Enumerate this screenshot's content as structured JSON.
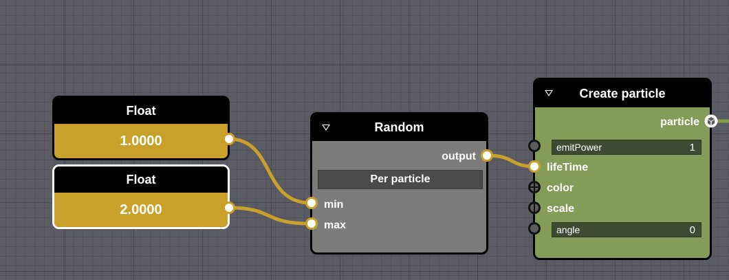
{
  "float_nodes": [
    {
      "title": "Float",
      "value": "1.0000"
    },
    {
      "title": "Float",
      "value": "2.0000"
    }
  ],
  "random_node": {
    "title": "Random",
    "output_label": "output",
    "mode": "Per particle",
    "inputs": [
      "min",
      "max"
    ]
  },
  "create_particle_node": {
    "title": "Create particle",
    "output_label": "particle",
    "inputs": [
      {
        "label": "emitPower",
        "value": "1"
      },
      {
        "label": "lifeTime"
      },
      {
        "label": "color"
      },
      {
        "label": "scale"
      },
      {
        "label": "angle",
        "value": "0"
      }
    ]
  },
  "colors": {
    "background": "#5b5b64",
    "float_value": "#c9a02a",
    "wire": "#c9a02a",
    "random_body": "#7c7c7c",
    "create_body": "#849c57",
    "particle_wire": "#84a048"
  },
  "icons": {
    "collapse": "triangle-down-icon",
    "particle_output": "cube-icon"
  }
}
